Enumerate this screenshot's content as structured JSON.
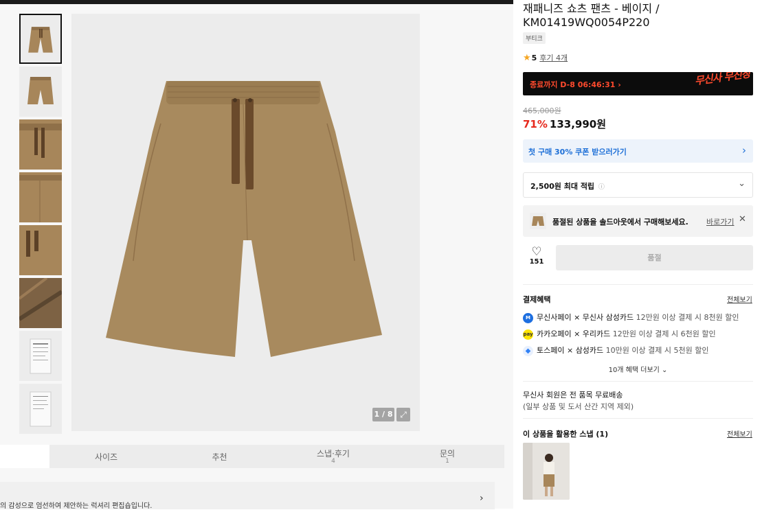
{
  "product": {
    "title": "재패니즈 쇼츠 팬츠 - 베이지 / KM01419WQ0054P220",
    "brand_tag": "부티크",
    "rating": "5",
    "reviews": "후기 4개",
    "star_icon": "star-icon"
  },
  "banner": {
    "timer": "종료까지 D-8 06:46:31 ›",
    "brand_text": "무신사 무진장"
  },
  "price": {
    "original": "465,000원",
    "discount": "71%",
    "current": "133,990원"
  },
  "coupon": {
    "label": "첫 구매 30% 쿠폰 받으러가기",
    "arrow": "›"
  },
  "points": {
    "label": "2,500원 최대 적립",
    "info": "ⓘ",
    "chevron": "⌄"
  },
  "soldout_notice": {
    "text": "품절된 상품을 솔드아웃에서 구매해보세요.",
    "link": "바로가기",
    "close": "✕"
  },
  "like": {
    "count": "151",
    "icon": "heart-icon"
  },
  "buy_button": {
    "label": "품절"
  },
  "payment": {
    "title": "결제혜택",
    "see_all": "전체보기",
    "items": [
      {
        "name": "무신사페이 × 무신사 삼성카드",
        "desc": " 12만원 이상 결제 시 8천원 할인",
        "color": "#1e6fe0"
      },
      {
        "name": "카카오페이 × 우리카드",
        "desc": " 12만원 이상 결제 시 6천원 할인",
        "color": "#fee500"
      },
      {
        "name": "토스페이 × 삼성카드",
        "desc": " 10만원 이상 결제 시 5천원 할인",
        "color": "#3182f6"
      }
    ],
    "more": "10개 혜택 더보기 ⌄"
  },
  "shipping": {
    "line1": "무신사 회원은 전 품목 무료배송",
    "line2": "(일부 상품 및 도서 산간 지역 제외)"
  },
  "snap": {
    "title": "이 상품을 활용한 스냅 (1)",
    "see_all": "전체보기"
  },
  "gallery": {
    "counter": "1 / 8",
    "expand_icon": "expand-icon"
  },
  "tabs": [
    {
      "label": "사이즈",
      "count": ""
    },
    {
      "label": "추천",
      "count": ""
    },
    {
      "label": "스냅·후기",
      "count": "4"
    },
    {
      "label": "문의",
      "count": "1"
    }
  ],
  "editor": {
    "text": "의 감성으로 엄선하여 제안하는 럭셔리 편집숍입니다.",
    "arrow": "›"
  }
}
